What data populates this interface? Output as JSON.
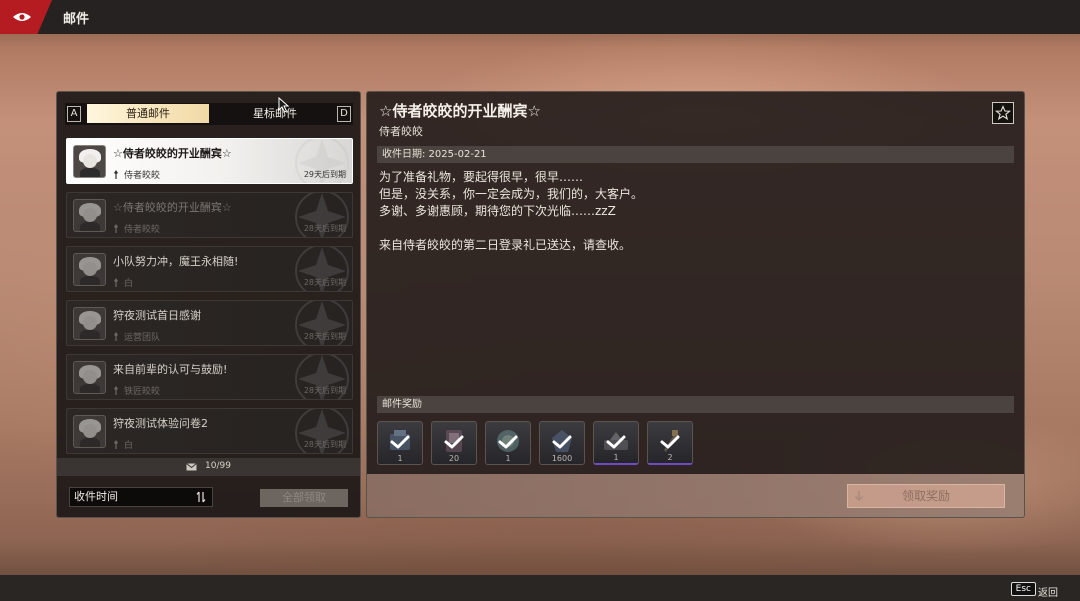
{
  "app": {
    "title": "邮件"
  },
  "tabs": {
    "left_key": "A",
    "right_key": "D",
    "normal_label": "普通邮件",
    "starred_label": "星标邮件"
  },
  "mail_list": [
    {
      "title": "☆侍者皎皎的开业酬宾☆",
      "sender": "侍者皎皎",
      "expire": "29天后到期",
      "selected": true
    },
    {
      "title": "☆侍者皎皎的开业酬宾☆",
      "sender": "侍者皎皎",
      "expire": "28天后到期",
      "selected": false
    },
    {
      "title": "小队努力冲，魔王永相随!",
      "sender": "白",
      "expire": "28天后到期",
      "selected": false
    },
    {
      "title": "狩夜测试首日感谢",
      "sender": "运营团队",
      "expire": "28天后到期",
      "selected": false
    },
    {
      "title": "来自前辈的认可与鼓励!",
      "sender": "铁匠皎皎",
      "expire": "28天后到期",
      "selected": false
    },
    {
      "title": "狩夜测试体验问卷2",
      "sender": "白",
      "expire": "28天后到期",
      "selected": false
    }
  ],
  "footer": {
    "mail_count": "10/99",
    "sort_label": "收件时间",
    "collect_all_label": "全部领取"
  },
  "detail": {
    "title": "☆侍者皎皎的开业酬宾☆",
    "sender": "侍者皎皎",
    "date_label": "收件日期: 2025-02-21",
    "body_lines": [
      "为了准备礼物，要起得很早，很早……",
      "但是，没关系，你一定会成为，我们的，大客户。",
      "多谢、多谢惠顾，期待您的下次光临……zzZ",
      "",
      "来自侍者皎皎的第二日登录礼已送达，请查收。"
    ],
    "rewards_label": "邮件奖励",
    "rewards": [
      {
        "qty": "1",
        "rarity": "normal"
      },
      {
        "qty": "20",
        "rarity": "normal"
      },
      {
        "qty": "1",
        "rarity": "normal"
      },
      {
        "qty": "1600",
        "rarity": "normal"
      },
      {
        "qty": "1",
        "rarity": "purple"
      },
      {
        "qty": "2",
        "rarity": "purple"
      }
    ],
    "claim_label": "领取奖励"
  },
  "bottom": {
    "esc_key": "Esc",
    "back_label": "返回"
  },
  "colors": {
    "brand_red": "#b41c22",
    "tab_active": "#f1d9a4",
    "rare_purple": "#6e4cc4"
  }
}
